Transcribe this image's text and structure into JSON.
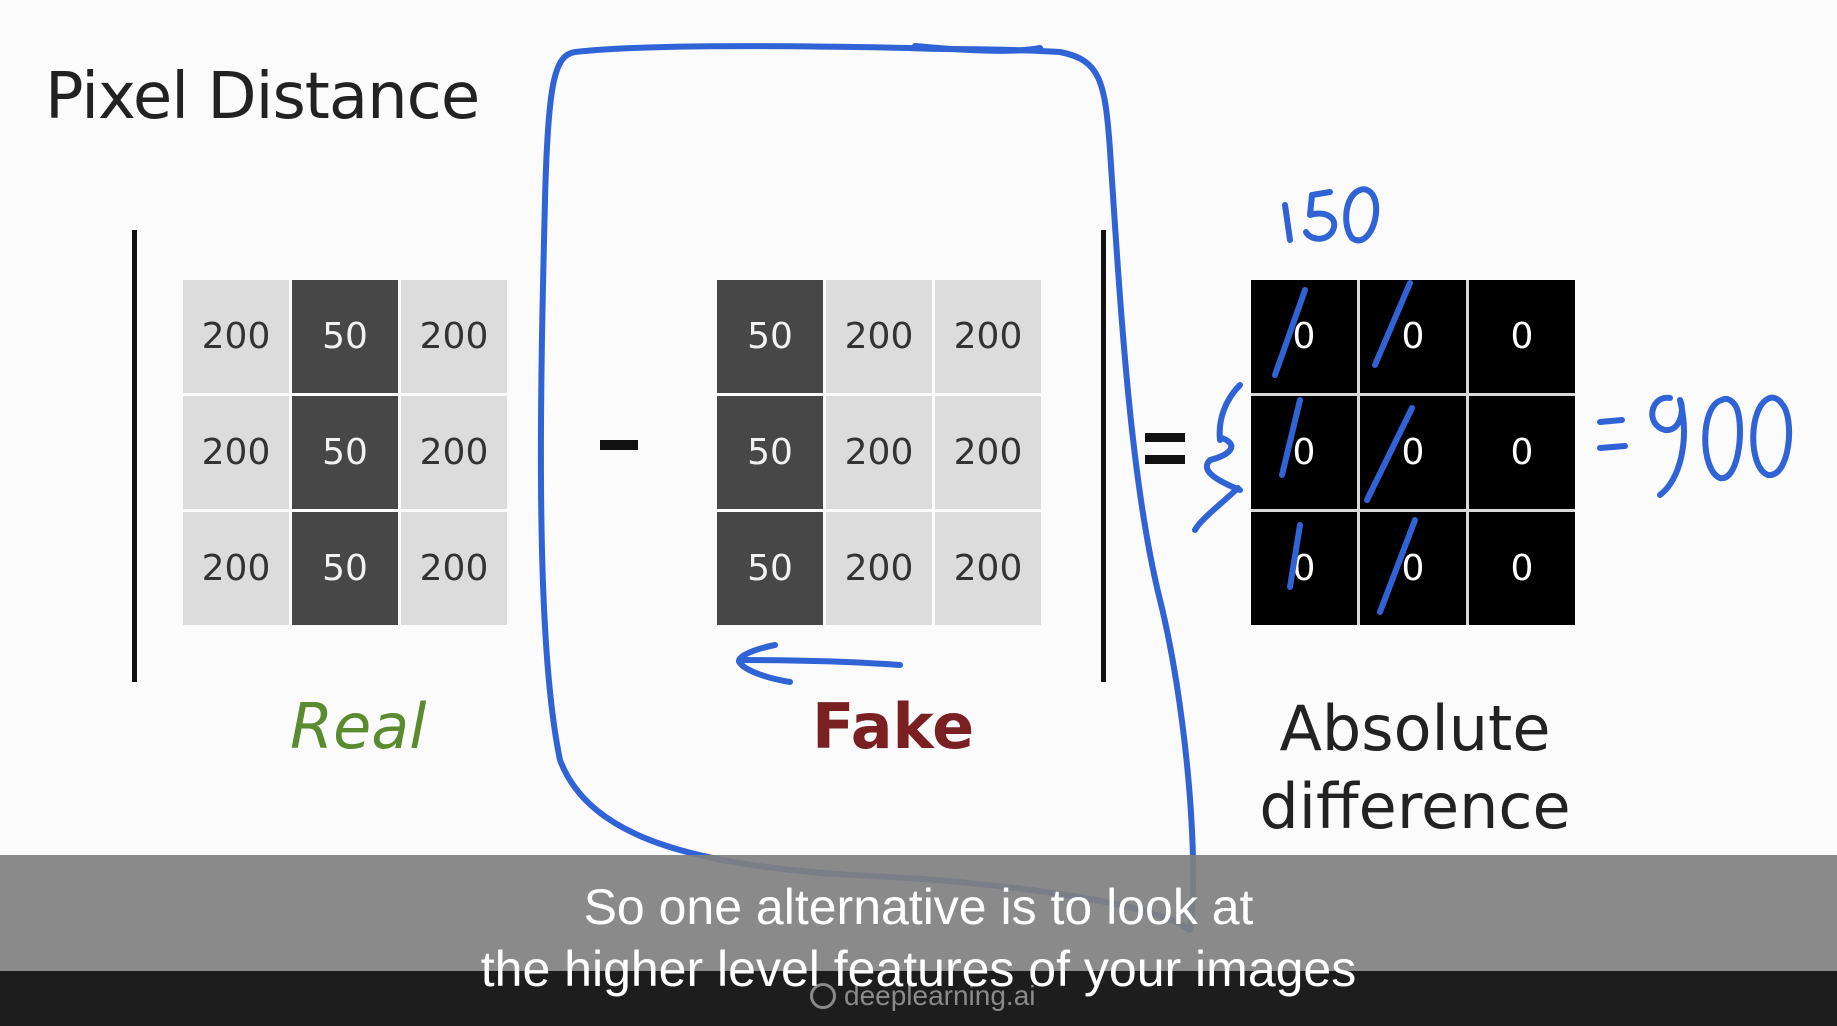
{
  "slide": {
    "title": "Pixel Distance",
    "operator_minus": "-",
    "operator_equals": "="
  },
  "matrices": {
    "real": {
      "label": "Real",
      "cells": [
        [
          "200",
          "50",
          "200"
        ],
        [
          "200",
          "50",
          "200"
        ],
        [
          "200",
          "50",
          "200"
        ]
      ]
    },
    "fake": {
      "label": "Fake",
      "cells": [
        [
          "50",
          "200",
          "200"
        ],
        [
          "50",
          "200",
          "200"
        ],
        [
          "50",
          "200",
          "200"
        ]
      ]
    },
    "absolute": {
      "label_line1": "Absolute",
      "label_line2": "difference",
      "cells": [
        [
          "0",
          "0",
          "0"
        ],
        [
          "0",
          "0",
          "0"
        ],
        [
          "0",
          "0",
          "0"
        ]
      ]
    }
  },
  "annotations": {
    "handwritten_top": "150",
    "handwritten_result": "=900",
    "ink_color": "#2f63d6"
  },
  "subtitles": {
    "line1": "So one alternative is to look at",
    "line2": "the higher level features of your images"
  },
  "watermark": {
    "text": "deeplearning.ai"
  },
  "colors": {
    "real_label": "#5a8b2e",
    "fake_label": "#7a1f22",
    "light_cell": "#dcdcdc",
    "dark_cell": "#474747",
    "black_cell": "#000000"
  }
}
